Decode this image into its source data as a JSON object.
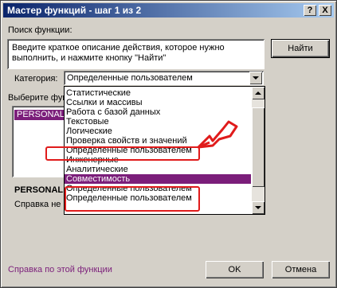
{
  "window": {
    "title": "Мастер функций - шаг 1 из 2",
    "help_btn": "?",
    "close_btn": "X"
  },
  "search": {
    "label": "Поиск функции:",
    "text": "Введите краткое описание действия, которое нужно выполнить, и нажмите кнопку \"Найти\"",
    "find_button": "Найти"
  },
  "category": {
    "label": "Категория:",
    "selected": "Определенные пользователем"
  },
  "select_function_label": "Выберите фун",
  "function_list": {
    "selected_item": "PERSONAL.."
  },
  "dropdown": {
    "items": [
      "Статистические",
      "Ссылки и массивы",
      "Работа с базой данных",
      "Текстовые",
      "Логические",
      "Проверка свойств и значений",
      "Определенные пользователем",
      "Инженерные",
      "Аналитические",
      "Совместимость",
      "Определенные пользователем",
      "Определенные пользователем"
    ],
    "selected_index": 9
  },
  "function_info": {
    "name": "PERSONAL.",
    "desc": "Справка не"
  },
  "footer": {
    "help_link": "Справка по этой функции",
    "ok": "OK",
    "cancel": "Отмена"
  },
  "colors": {
    "highlight": "#7b1e7a",
    "annotation": "#e01b1b"
  }
}
